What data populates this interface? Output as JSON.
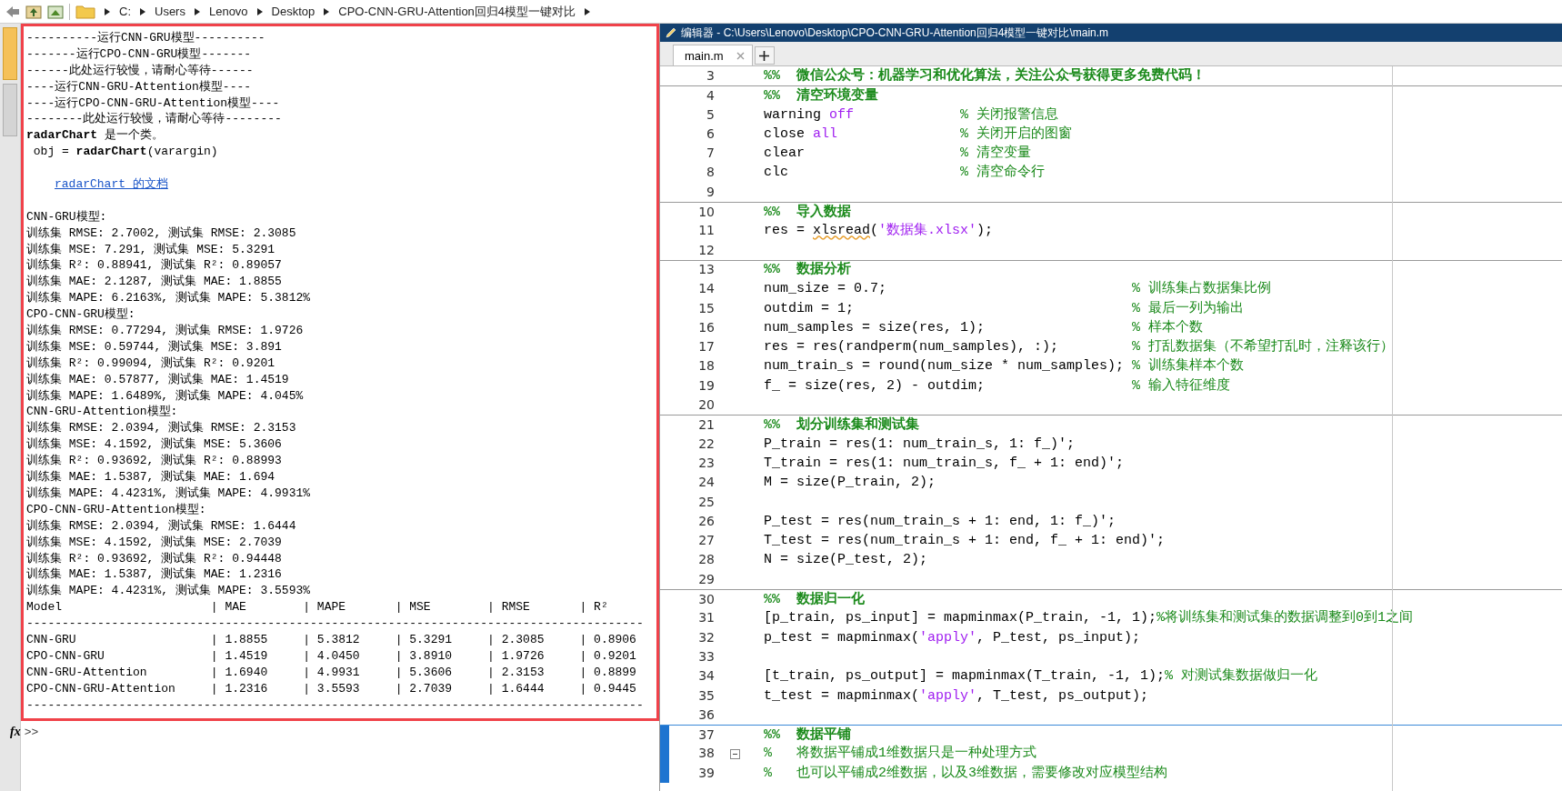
{
  "address_bar": {
    "crumbs": [
      "C:",
      "Users",
      "Lenovo",
      "Desktop",
      "CPO-CNN-GRU-Attention回归4模型一键对比"
    ]
  },
  "console": {
    "lines": [
      {
        "kind": "text",
        "text": "----------运行CNN-GRU模型----------"
      },
      {
        "kind": "text",
        "text": "-------运行CPO-CNN-GRU模型-------"
      },
      {
        "kind": "text",
        "text": "------此处运行较慢，请耐心等待------"
      },
      {
        "kind": "text",
        "text": "----运行CNN-GRU-Attention模型----"
      },
      {
        "kind": "text",
        "text": "----运行CPO-CNN-GRU-Attention模型----"
      },
      {
        "kind": "text",
        "text": "--------此处运行较慢，请耐心等待--------"
      },
      {
        "kind": "text",
        "text": "**radarChart** 是一个类。"
      },
      {
        "kind": "text",
        "text": " obj = **radarChart**(varargin)"
      },
      {
        "kind": "blank"
      },
      {
        "kind": "link",
        "text": "radarChart 的文档"
      },
      {
        "kind": "blank"
      },
      {
        "kind": "text",
        "text": "CNN-GRU模型:"
      },
      {
        "kind": "text",
        "text": "训练集 RMSE: 2.7002, 测试集 RMSE: 2.3085"
      },
      {
        "kind": "text",
        "text": "训练集 MSE: 7.291, 测试集 MSE: 5.3291"
      },
      {
        "kind": "text",
        "text": "训练集 R²: 0.88941, 测试集 R²: 0.89057"
      },
      {
        "kind": "text",
        "text": "训练集 MAE: 2.1287, 测试集 MAE: 1.8855"
      },
      {
        "kind": "text",
        "text": "训练集 MAPE: 6.2163%, 测试集 MAPE: 5.3812%"
      },
      {
        "kind": "text",
        "text": "CPO-CNN-GRU模型:"
      },
      {
        "kind": "text",
        "text": "训练集 RMSE: 0.77294, 测试集 RMSE: 1.9726"
      },
      {
        "kind": "text",
        "text": "训练集 MSE: 0.59744, 测试集 MSE: 3.891"
      },
      {
        "kind": "text",
        "text": "训练集 R²: 0.99094, 测试集 R²: 0.9201"
      },
      {
        "kind": "text",
        "text": "训练集 MAE: 0.57877, 测试集 MAE: 1.4519"
      },
      {
        "kind": "text",
        "text": "训练集 MAPE: 1.6489%, 测试集 MAPE: 4.045%"
      },
      {
        "kind": "text",
        "text": "CNN-GRU-Attention模型:"
      },
      {
        "kind": "text",
        "text": "训练集 RMSE: 2.0394, 测试集 RMSE: 2.3153"
      },
      {
        "kind": "text",
        "text": "训练集 MSE: 4.1592, 测试集 MSE: 5.3606"
      },
      {
        "kind": "text",
        "text": "训练集 R²: 0.93692, 测试集 R²: 0.88993"
      },
      {
        "kind": "text",
        "text": "训练集 MAE: 1.5387, 测试集 MAE: 1.694"
      },
      {
        "kind": "text",
        "text": "训练集 MAPE: 4.4231%, 测试集 MAPE: 4.9931%"
      },
      {
        "kind": "text",
        "text": "CPO-CNN-GRU-Attention模型:"
      },
      {
        "kind": "text",
        "text": "训练集 RMSE: 2.0394, 测试集 RMSE: 1.6444"
      },
      {
        "kind": "text",
        "text": "训练集 MSE: 4.1592, 测试集 MSE: 2.7039"
      },
      {
        "kind": "text",
        "text": "训练集 R²: 0.93692, 测试集 R²: 0.94448"
      },
      {
        "kind": "text",
        "text": "训练集 MAE: 1.5387, 测试集 MAE: 1.2316"
      },
      {
        "kind": "text",
        "text": "训练集 MAPE: 4.4231%, 测试集 MAPE: 3.5593%"
      },
      {
        "kind": "table",
        "text": "Model                     | MAE        | MAPE       | MSE        | RMSE       | R²"
      },
      {
        "kind": "rule",
        "text": "---------------------------------------------------------------------------------------"
      },
      {
        "kind": "table",
        "text": "CNN-GRU                   | 1.8855     | 5.3812     | 5.3291     | 2.3085     | 0.8906"
      },
      {
        "kind": "table",
        "text": "CPO-CNN-GRU               | 1.4519     | 4.0450     | 3.8910     | 1.9726     | 0.9201"
      },
      {
        "kind": "table",
        "text": "CNN-GRU-Attention         | 1.6940     | 4.9931     | 5.3606     | 2.3153     | 0.8899"
      },
      {
        "kind": "table",
        "text": "CPO-CNN-GRU-Attention     | 1.2316     | 3.5593     | 2.7039     | 1.6444     | 0.9445"
      },
      {
        "kind": "rule",
        "text": "---------------------------------------------------------------------------------------"
      }
    ],
    "fx_label": "fx",
    "prompt": ">>"
  },
  "editor": {
    "title": "编辑器 - C:\\Users\\Lenovo\\Desktop\\CPO-CNN-GRU-Attention回归4模型一键对比\\main.m",
    "tabs": [
      {
        "label": "main.m",
        "selected": true
      }
    ],
    "lines": [
      {
        "number": "3",
        "section_start": false,
        "active_cell": false,
        "fold": false,
        "segments": [
          {
            "kind": "section",
            "text": "%%  微信公众号：机器学习和优化算法，关注公众号获得更多免费代码！"
          }
        ]
      },
      {
        "number": "4",
        "section_start": true,
        "active_cell": false,
        "fold": false,
        "segments": [
          {
            "kind": "section",
            "text": "%%  清空环境变量"
          }
        ]
      },
      {
        "number": "5",
        "section_start": false,
        "active_cell": false,
        "fold": false,
        "segments": [
          {
            "kind": "code",
            "text": "warning "
          },
          {
            "kind": "keyword",
            "text": "off"
          },
          {
            "kind": "comment",
            "text": "             % 关闭报警信息"
          }
        ]
      },
      {
        "number": "6",
        "section_start": false,
        "active_cell": false,
        "fold": false,
        "segments": [
          {
            "kind": "code",
            "text": "close "
          },
          {
            "kind": "keyword",
            "text": "all"
          },
          {
            "kind": "comment",
            "text": "               % 关闭开启的图窗"
          }
        ]
      },
      {
        "number": "7",
        "section_start": false,
        "active_cell": false,
        "fold": false,
        "segments": [
          {
            "kind": "code",
            "text": "clear                   "
          },
          {
            "kind": "comment",
            "text": "% 清空变量"
          }
        ]
      },
      {
        "number": "8",
        "section_start": false,
        "active_cell": false,
        "fold": false,
        "segments": [
          {
            "kind": "code",
            "text": "clc                     "
          },
          {
            "kind": "comment",
            "text": "% 清空命令行"
          }
        ]
      },
      {
        "number": "9",
        "section_start": false,
        "active_cell": false,
        "fold": false
      },
      {
        "number": "10",
        "section_start": true,
        "active_cell": false,
        "fold": false,
        "segments": [
          {
            "kind": "section",
            "text": "%%  导入数据"
          }
        ]
      },
      {
        "number": "11",
        "section_start": false,
        "active_cell": false,
        "fold": false,
        "segments": [
          {
            "kind": "code",
            "text": "res = "
          },
          {
            "kind": "warn",
            "text": "xlsread"
          },
          {
            "kind": "code",
            "text": "("
          },
          {
            "kind": "string",
            "text": "'数据集.xlsx'"
          },
          {
            "kind": "code",
            "text": ");"
          }
        ]
      },
      {
        "number": "12",
        "section_start": false,
        "active_cell": false,
        "fold": false
      },
      {
        "number": "13",
        "section_start": true,
        "active_cell": false,
        "fold": false,
        "segments": [
          {
            "kind": "section",
            "text": "%%  数据分析"
          }
        ]
      },
      {
        "number": "14",
        "section_start": false,
        "active_cell": false,
        "fold": false,
        "segments": [
          {
            "kind": "code",
            "text": "num_size = 0.7;                              "
          },
          {
            "kind": "comment",
            "text": "% 训练集占数据集比例"
          }
        ]
      },
      {
        "number": "15",
        "section_start": false,
        "active_cell": false,
        "fold": false,
        "segments": [
          {
            "kind": "code",
            "text": "outdim = 1;                                  "
          },
          {
            "kind": "comment",
            "text": "% 最后一列为输出"
          }
        ]
      },
      {
        "number": "16",
        "section_start": false,
        "active_cell": false,
        "fold": false,
        "segments": [
          {
            "kind": "code",
            "text": "num_samples = size(res, 1);                  "
          },
          {
            "kind": "comment",
            "text": "% 样本个数"
          }
        ]
      },
      {
        "number": "17",
        "section_start": false,
        "active_cell": false,
        "fold": false,
        "segments": [
          {
            "kind": "code",
            "text": "res = res(randperm(num_samples), :);         "
          },
          {
            "kind": "comment",
            "text": "% 打乱数据集（不希望打乱时，注释该行）"
          }
        ]
      },
      {
        "number": "18",
        "section_start": false,
        "active_cell": false,
        "fold": false,
        "segments": [
          {
            "kind": "code",
            "text": "num_train_s = round(num_size * num_samples); "
          },
          {
            "kind": "comment",
            "text": "% 训练集样本个数"
          }
        ]
      },
      {
        "number": "19",
        "section_start": false,
        "active_cell": false,
        "fold": false,
        "segments": [
          {
            "kind": "code",
            "text": "f_ = size(res, 2) - outdim;                  "
          },
          {
            "kind": "comment",
            "text": "% 输入特征维度"
          }
        ]
      },
      {
        "number": "20",
        "section_start": false,
        "active_cell": false,
        "fold": false
      },
      {
        "number": "21",
        "section_start": true,
        "active_cell": false,
        "fold": false,
        "segments": [
          {
            "kind": "section",
            "text": "%%  划分训练集和测试集"
          }
        ]
      },
      {
        "number": "22",
        "section_start": false,
        "active_cell": false,
        "fold": false,
        "segments": [
          {
            "kind": "code",
            "text": "P_train = res(1: num_train_s, 1: f_)';"
          }
        ]
      },
      {
        "number": "23",
        "section_start": false,
        "active_cell": false,
        "fold": false,
        "segments": [
          {
            "kind": "code",
            "text": "T_train = res(1: num_train_s, f_ + 1: end)';"
          }
        ]
      },
      {
        "number": "24",
        "section_start": false,
        "active_cell": false,
        "fold": false,
        "segments": [
          {
            "kind": "code",
            "text": "M = size(P_train, 2);"
          }
        ]
      },
      {
        "number": "25",
        "section_start": false,
        "active_cell": false,
        "fold": false
      },
      {
        "number": "26",
        "section_start": false,
        "active_cell": false,
        "fold": false,
        "segments": [
          {
            "kind": "code",
            "text": "P_test = res(num_train_s + 1: end, 1: f_)';"
          }
        ]
      },
      {
        "number": "27",
        "section_start": false,
        "active_cell": false,
        "fold": false,
        "segments": [
          {
            "kind": "code",
            "text": "T_test = res(num_train_s + 1: end, f_ + 1: end)';"
          }
        ]
      },
      {
        "number": "28",
        "section_start": false,
        "active_cell": false,
        "fold": false,
        "segments": [
          {
            "kind": "code",
            "text": "N = size(P_test, 2);"
          }
        ]
      },
      {
        "number": "29",
        "section_start": false,
        "active_cell": false,
        "fold": false
      },
      {
        "number": "30",
        "section_start": true,
        "active_cell": false,
        "fold": false,
        "segments": [
          {
            "kind": "section",
            "text": "%%  数据归一化"
          }
        ]
      },
      {
        "number": "31",
        "section_start": false,
        "active_cell": false,
        "fold": false,
        "segments": [
          {
            "kind": "code",
            "text": "[p_train, ps_input] = mapminmax(P_train, -1, 1);"
          },
          {
            "kind": "comment",
            "text": "%将训练集和测试集的数据调整到0到1之间"
          }
        ]
      },
      {
        "number": "32",
        "section_start": false,
        "active_cell": false,
        "fold": false,
        "segments": [
          {
            "kind": "code",
            "text": "p_test = mapminmax("
          },
          {
            "kind": "string",
            "text": "'apply'"
          },
          {
            "kind": "code",
            "text": ", P_test, ps_input);"
          }
        ]
      },
      {
        "number": "33",
        "section_start": false,
        "active_cell": false,
        "fold": false
      },
      {
        "number": "34",
        "section_start": false,
        "active_cell": false,
        "fold": false,
        "segments": [
          {
            "kind": "code",
            "text": "[t_train, ps_output] = mapminmax(T_train, -1, 1);"
          },
          {
            "kind": "comment",
            "text": "% 对测试集数据做归一化"
          }
        ]
      },
      {
        "number": "35",
        "section_start": false,
        "active_cell": false,
        "fold": false,
        "segments": [
          {
            "kind": "code",
            "text": "t_test = mapminmax("
          },
          {
            "kind": "string",
            "text": "'apply'"
          },
          {
            "kind": "code",
            "text": ", T_test, ps_output);"
          }
        ]
      },
      {
        "number": "36",
        "section_start": false,
        "active_cell": false,
        "fold": false
      },
      {
        "number": "37",
        "section_start": true,
        "active_cell": true,
        "fold": false,
        "segments": [
          {
            "kind": "section",
            "text": "%%  数据平铺"
          }
        ]
      },
      {
        "number": "38",
        "section_start": false,
        "active_cell": true,
        "fold": true,
        "segments": [
          {
            "kind": "comment",
            "text": "%   将数据平铺成1维数据只是一种处理方式"
          }
        ]
      },
      {
        "number": "39",
        "section_start": false,
        "active_cell": true,
        "fold": false,
        "segments": [
          {
            "kind": "comment",
            "text": "%   也可以平铺成2维数据，以及3维数据，需要修改对应模型结构"
          }
        ]
      }
    ]
  }
}
